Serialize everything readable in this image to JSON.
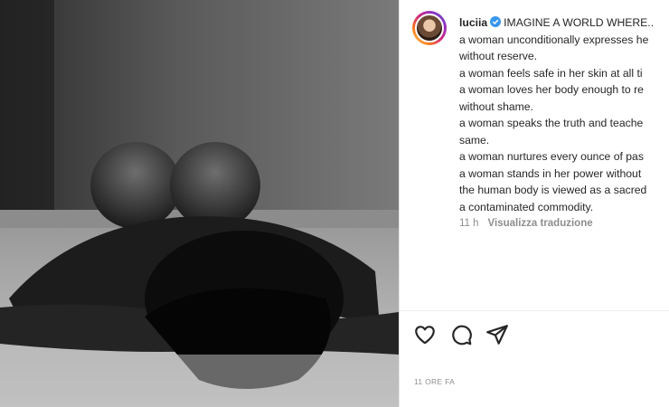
{
  "post": {
    "username": "luciia",
    "caption_title": "IMAGINE A WORLD WHERE..",
    "caption_lines": [
      "a woman unconditionally expresses he",
      "without reserve.",
      "a woman feels safe in her skin at all ti",
      "a woman loves her body enough to re",
      "without shame.",
      "a woman speaks the truth and teache",
      "same.",
      "a woman nurtures every ounce of pas",
      "a woman stands in her power without",
      "the human body is viewed as a sacred",
      "a contaminated commodity."
    ],
    "time_ago": "11 h",
    "translate_label": "Visualizza traduzione",
    "timestamp": "11 ORE FA"
  },
  "icons": {
    "like": "heart-icon",
    "comment": "comment-icon",
    "share": "paper-plane-icon",
    "verified": "verified-badge-icon"
  },
  "colors": {
    "verified": "#3897f0",
    "muted": "#8e8e8e",
    "text": "#262626"
  }
}
